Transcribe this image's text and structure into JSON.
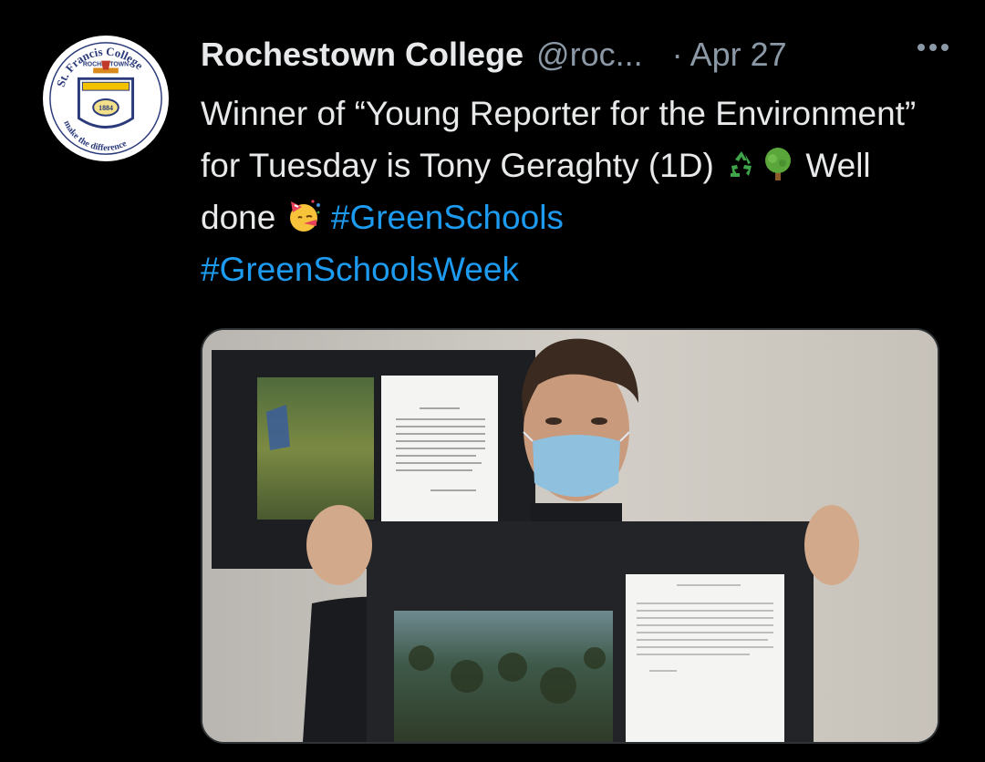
{
  "tweet": {
    "author_name": "Rochestown College",
    "handle": "@roc...",
    "separator": "·",
    "date": "Apr 27",
    "text_part1": "Winner of “Young Reporter for the Environment” for Tuesday is Tony Geraghty (1D) ",
    "text_part2": " Well done ",
    "hashtag1": "#GreenSchools",
    "hashtag2": "#GreenSchoolsWeek"
  },
  "avatar": {
    "ring_text": "St. Francis College",
    "sub_text": "ROCHESTOWN",
    "year": "1884",
    "motto": "make the difference"
  },
  "colors": {
    "background": "#000000",
    "text": "#e7e9ea",
    "secondary": "#8b98a5",
    "link": "#1d9bf0"
  },
  "icons": [
    "recycle-icon",
    "tree-icon",
    "party-face-icon",
    "more-options-icon"
  ]
}
